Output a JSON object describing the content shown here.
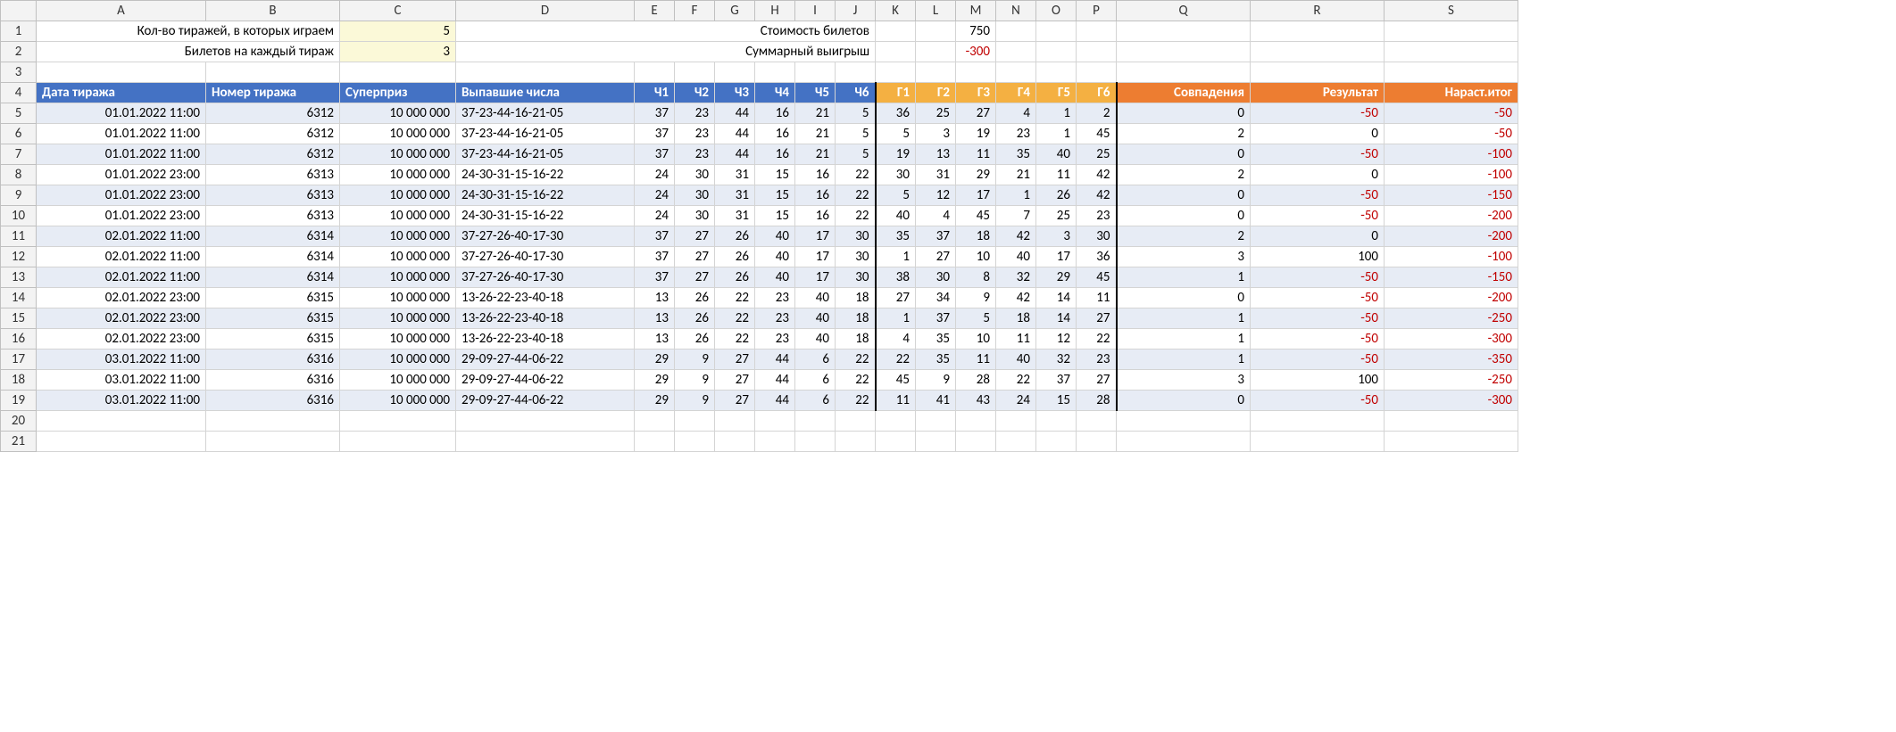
{
  "summary": {
    "row1_labelA": "Кол-во тиражей, в которых играем",
    "row1_valueC": "5",
    "row1_labelDJ": "Стоимость билетов",
    "row1_valueM": "750",
    "row2_labelA": "Билетов на каждый тираж",
    "row2_valueC": "3",
    "row2_labelDJ": "Суммарный выигрыш",
    "row2_valueM": "-300"
  },
  "headers": {
    "A": "Дата тиража",
    "B": "Номер тиража",
    "C": "Суперприз",
    "D": "Выпавшие числа",
    "E": "Ч1",
    "F": "Ч2",
    "G": "Ч3",
    "H": "Ч4",
    "I": "Ч5",
    "J": "Ч6",
    "K": "Г1",
    "L": "Г2",
    "M": "Г3",
    "N": "Г4",
    "O": "Г5",
    "P": "Г6",
    "Q": "Совпадения",
    "R": "Результат",
    "S": "Нараст.итог"
  },
  "rows": [
    {
      "date": "01.01.2022 11:00",
      "draw": "6312",
      "prize": "10 000 000",
      "nums": "37-23-44-16-21-05",
      "ch": [
        "37",
        "23",
        "44",
        "16",
        "21",
        "5"
      ],
      "g": [
        "36",
        "25",
        "27",
        "4",
        "1",
        "2"
      ],
      "match": "0",
      "res": "-50",
      "cum": "-50"
    },
    {
      "date": "01.01.2022 11:00",
      "draw": "6312",
      "prize": "10 000 000",
      "nums": "37-23-44-16-21-05",
      "ch": [
        "37",
        "23",
        "44",
        "16",
        "21",
        "5"
      ],
      "g": [
        "5",
        "3",
        "19",
        "23",
        "1",
        "45"
      ],
      "match": "2",
      "res": "0",
      "cum": "-50"
    },
    {
      "date": "01.01.2022 11:00",
      "draw": "6312",
      "prize": "10 000 000",
      "nums": "37-23-44-16-21-05",
      "ch": [
        "37",
        "23",
        "44",
        "16",
        "21",
        "5"
      ],
      "g": [
        "19",
        "13",
        "11",
        "35",
        "40",
        "25"
      ],
      "match": "0",
      "res": "-50",
      "cum": "-100"
    },
    {
      "date": "01.01.2022 23:00",
      "draw": "6313",
      "prize": "10 000 000",
      "nums": "24-30-31-15-16-22",
      "ch": [
        "24",
        "30",
        "31",
        "15",
        "16",
        "22"
      ],
      "g": [
        "30",
        "31",
        "29",
        "21",
        "11",
        "42"
      ],
      "match": "2",
      "res": "0",
      "cum": "-100"
    },
    {
      "date": "01.01.2022 23:00",
      "draw": "6313",
      "prize": "10 000 000",
      "nums": "24-30-31-15-16-22",
      "ch": [
        "24",
        "30",
        "31",
        "15",
        "16",
        "22"
      ],
      "g": [
        "5",
        "12",
        "17",
        "1",
        "26",
        "42"
      ],
      "match": "0",
      "res": "-50",
      "cum": "-150"
    },
    {
      "date": "01.01.2022 23:00",
      "draw": "6313",
      "prize": "10 000 000",
      "nums": "24-30-31-15-16-22",
      "ch": [
        "24",
        "30",
        "31",
        "15",
        "16",
        "22"
      ],
      "g": [
        "40",
        "4",
        "45",
        "7",
        "25",
        "23"
      ],
      "match": "0",
      "res": "-50",
      "cum": "-200"
    },
    {
      "date": "02.01.2022 11:00",
      "draw": "6314",
      "prize": "10 000 000",
      "nums": "37-27-26-40-17-30",
      "ch": [
        "37",
        "27",
        "26",
        "40",
        "17",
        "30"
      ],
      "g": [
        "35",
        "37",
        "18",
        "42",
        "3",
        "30"
      ],
      "match": "2",
      "res": "0",
      "cum": "-200"
    },
    {
      "date": "02.01.2022 11:00",
      "draw": "6314",
      "prize": "10 000 000",
      "nums": "37-27-26-40-17-30",
      "ch": [
        "37",
        "27",
        "26",
        "40",
        "17",
        "30"
      ],
      "g": [
        "1",
        "27",
        "10",
        "40",
        "17",
        "36"
      ],
      "match": "3",
      "res": "100",
      "cum": "-100"
    },
    {
      "date": "02.01.2022 11:00",
      "draw": "6314",
      "prize": "10 000 000",
      "nums": "37-27-26-40-17-30",
      "ch": [
        "37",
        "27",
        "26",
        "40",
        "17",
        "30"
      ],
      "g": [
        "38",
        "30",
        "8",
        "32",
        "29",
        "45"
      ],
      "match": "1",
      "res": "-50",
      "cum": "-150"
    },
    {
      "date": "02.01.2022 23:00",
      "draw": "6315",
      "prize": "10 000 000",
      "nums": "13-26-22-23-40-18",
      "ch": [
        "13",
        "26",
        "22",
        "23",
        "40",
        "18"
      ],
      "g": [
        "27",
        "34",
        "9",
        "42",
        "14",
        "11"
      ],
      "match": "0",
      "res": "-50",
      "cum": "-200"
    },
    {
      "date": "02.01.2022 23:00",
      "draw": "6315",
      "prize": "10 000 000",
      "nums": "13-26-22-23-40-18",
      "ch": [
        "13",
        "26",
        "22",
        "23",
        "40",
        "18"
      ],
      "g": [
        "1",
        "37",
        "5",
        "18",
        "14",
        "27"
      ],
      "match": "1",
      "res": "-50",
      "cum": "-250"
    },
    {
      "date": "02.01.2022 23:00",
      "draw": "6315",
      "prize": "10 000 000",
      "nums": "13-26-22-23-40-18",
      "ch": [
        "13",
        "26",
        "22",
        "23",
        "40",
        "18"
      ],
      "g": [
        "4",
        "35",
        "10",
        "11",
        "12",
        "22"
      ],
      "match": "1",
      "res": "-50",
      "cum": "-300"
    },
    {
      "date": "03.01.2022 11:00",
      "draw": "6316",
      "prize": "10 000 000",
      "nums": "29-09-27-44-06-22",
      "ch": [
        "29",
        "9",
        "27",
        "44",
        "6",
        "22"
      ],
      "g": [
        "22",
        "35",
        "11",
        "40",
        "32",
        "23"
      ],
      "match": "1",
      "res": "-50",
      "cum": "-350"
    },
    {
      "date": "03.01.2022 11:00",
      "draw": "6316",
      "prize": "10 000 000",
      "nums": "29-09-27-44-06-22",
      "ch": [
        "29",
        "9",
        "27",
        "44",
        "6",
        "22"
      ],
      "g": [
        "45",
        "9",
        "28",
        "22",
        "37",
        "27"
      ],
      "match": "3",
      "res": "100",
      "cum": "-250"
    },
    {
      "date": "03.01.2022 11:00",
      "draw": "6316",
      "prize": "10 000 000",
      "nums": "29-09-27-44-06-22",
      "ch": [
        "29",
        "9",
        "27",
        "44",
        "6",
        "22"
      ],
      "g": [
        "11",
        "41",
        "43",
        "24",
        "15",
        "28"
      ],
      "match": "0",
      "res": "-50",
      "cum": "-300"
    }
  ],
  "columns": [
    "A",
    "B",
    "C",
    "D",
    "E",
    "F",
    "G",
    "H",
    "I",
    "J",
    "K",
    "L",
    "M",
    "N",
    "O",
    "P",
    "Q",
    "R",
    "S"
  ],
  "col_widths": {
    "rh": 40,
    "A": 190,
    "B": 150,
    "C": 130,
    "D": 200,
    "E": 45,
    "F": 45,
    "G": 45,
    "H": 45,
    "I": 45,
    "J": 45,
    "K": 45,
    "L": 45,
    "M": 45,
    "N": 45,
    "O": 45,
    "P": 45,
    "Q": 150,
    "R": 150,
    "S": 150
  },
  "first_data_rownum": 5,
  "extra_blank_rows": 2
}
